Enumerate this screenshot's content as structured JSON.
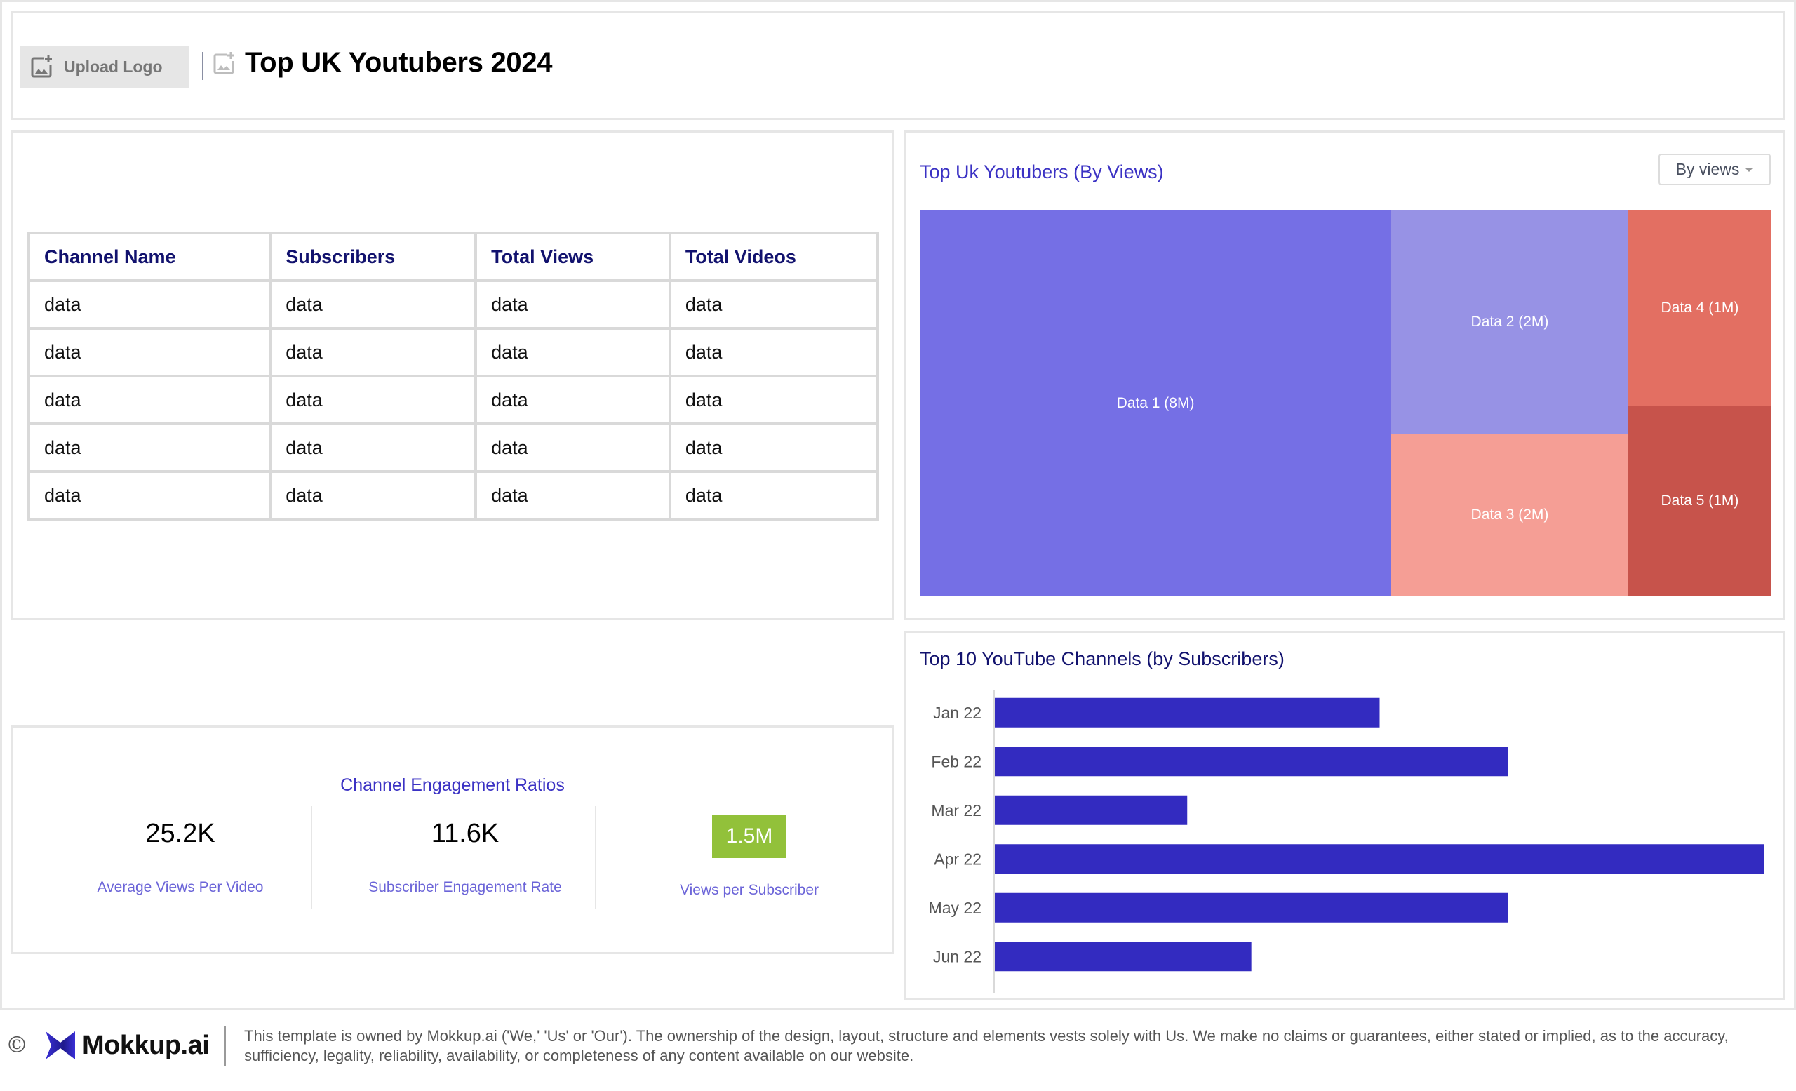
{
  "header": {
    "upload_logo_label": "Upload Logo",
    "title": "Top UK Youtubers 2024"
  },
  "table": {
    "columns": [
      "Channel Name",
      "Subscribers",
      "Total Views",
      "Total Videos"
    ],
    "rows": [
      [
        "data",
        "data",
        "data",
        "data"
      ],
      [
        "data",
        "data",
        "data",
        "data"
      ],
      [
        "data",
        "data",
        "data",
        "data"
      ],
      [
        "data",
        "data",
        "data",
        "data"
      ],
      [
        "data",
        "data",
        "data",
        "data"
      ]
    ]
  },
  "treemap_card": {
    "title": "Top Uk Youtubers (By Views)",
    "dropdown_selected": "By views"
  },
  "engagement": {
    "title": "Channel Engagement Ratios",
    "kpis": [
      {
        "value": "25.2K",
        "label": "Average Views Per Video"
      },
      {
        "value": "11.6K",
        "label": "Subscriber Engagement Rate"
      },
      {
        "value": "1.5M",
        "label": "Views per Subscriber",
        "highlight_color": "#92c13a"
      }
    ]
  },
  "bar_card": {
    "title": "Top 10 YouTube Channels (by Subscribers)"
  },
  "chart_data": [
    {
      "type": "treemap",
      "title": "Top Uk Youtubers (By Views)",
      "items": [
        {
          "name": "Data 1",
          "label": "Data 1 (8M)",
          "value": 8,
          "color": "#756fe5"
        },
        {
          "name": "Data 2",
          "label": "Data 2 (2M)",
          "value": 2,
          "color": "#9792e5"
        },
        {
          "name": "Data 3",
          "label": "Data 3 (2M)",
          "value": 2,
          "color": "#f59e95"
        },
        {
          "name": "Data 4",
          "label": "Data 4 (1M)",
          "value": 1,
          "color": "#e36f62"
        },
        {
          "name": "Data 5",
          "label": "Data 5 (1M)",
          "value": 1,
          "color": "#c7534b"
        }
      ],
      "unit": "M"
    },
    {
      "type": "bar",
      "orientation": "horizontal",
      "title": "Top 10 YouTube Channels (by Subscribers)",
      "categories": [
        "Jan 22",
        "Feb 22",
        "Mar 22",
        "Apr 22",
        "May 22",
        "Jun 22"
      ],
      "values": [
        6,
        8,
        3,
        12,
        8,
        4
      ],
      "xlim": [
        0,
        12
      ],
      "bar_color": "#332bc0",
      "grid": false,
      "xlabel": "",
      "ylabel": ""
    }
  ],
  "footer": {
    "copyright_symbol": "©",
    "brand": "Mokkup.ai",
    "disclaimer": "This template is owned by Mokkup.ai ('We,' 'Us' or 'Our'). The ownership of the design, layout, structure and elements vests solely with Us. We make no claims or guarantees, either stated or implied, as to the accuracy, sufficiency, legality, reliability, availability, or completeness of any content available on our website."
  }
}
